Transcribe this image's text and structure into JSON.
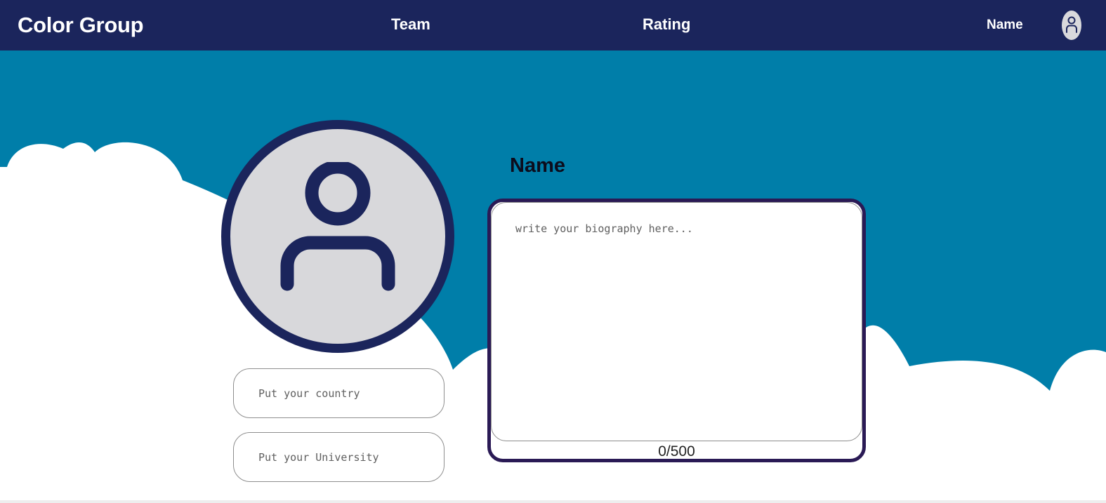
{
  "nav": {
    "brand": "Color Group",
    "links": [
      "Team",
      "Rating"
    ],
    "user_name": "Name",
    "avatar_icon": "user-icon"
  },
  "profile": {
    "picture_icon": "user-icon",
    "name": "Name",
    "country_placeholder": "Put your country",
    "university_placeholder": "Put your University",
    "bio_placeholder": "write your biography here...",
    "bio_counter": "0/500"
  },
  "colors": {
    "navbar": "#1b255c",
    "sky": "#007ea9",
    "cloud": "#ffffff",
    "avatar_ring": "#1b255c",
    "avatar_fill": "#d8d8db",
    "bio_border": "#2a1a55"
  }
}
